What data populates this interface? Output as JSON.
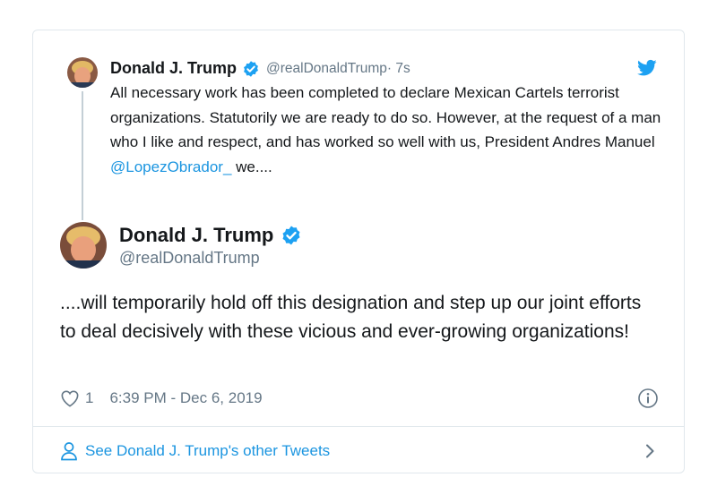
{
  "parent_tweet": {
    "author_name": "Donald J. Trump",
    "handle": "@realDonaldTrump",
    "time": " · 7s",
    "text_part1": "All necessary work has been completed to declare Mexican Cartels terrorist organizations. Statutorily we are ready to do so. However, at the request of a man who I like and respect, and has worked so well with us, President Andres Manuel ",
    "mention": "@LopezObrador_",
    "text_part2": " we...."
  },
  "main_tweet": {
    "author_name": "Donald J. Trump",
    "handle": "@realDonaldTrump",
    "text": "....will temporarily hold off this designation and step up our joint efforts to deal decisively with these vicious and ever-growing organizations!",
    "like_count": "1",
    "timestamp": "6:39 PM - Dec 6, 2019"
  },
  "footer": {
    "link_text": "See Donald J. Trump's other Tweets"
  },
  "colors": {
    "accent": "#1b95e0",
    "text": "#14171a",
    "muted": "#657786",
    "border": "#e1e8ed"
  },
  "icons": {
    "brand": "twitter-bird-icon",
    "verified": "verified-badge-icon",
    "like": "heart-icon",
    "info": "info-icon",
    "profile": "person-icon",
    "navigate": "chevron-right-icon"
  }
}
